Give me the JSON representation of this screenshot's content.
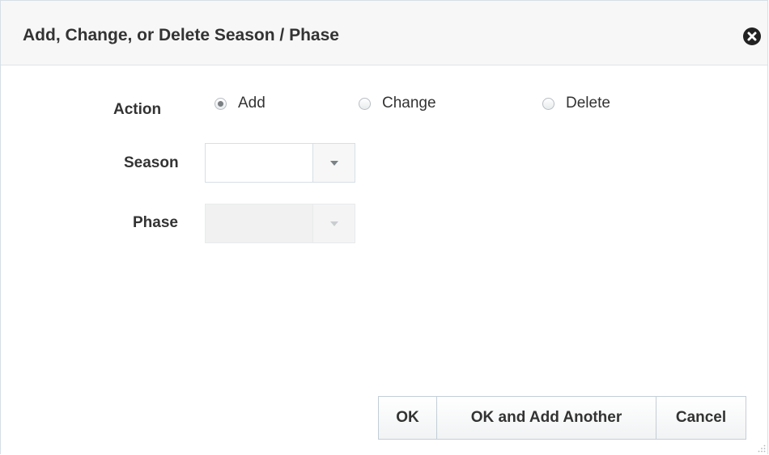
{
  "dialog": {
    "title": "Add, Change, or Delete Season / Phase"
  },
  "form": {
    "action_label": "Action",
    "action_options": [
      "Add",
      "Change",
      "Delete"
    ],
    "action_selected": "Add",
    "season_label": "Season",
    "season_value": "",
    "phase_label": "Phase",
    "phase_value": ""
  },
  "buttons": {
    "ok": "OK",
    "ok_add_another": "OK and Add Another",
    "cancel": "Cancel"
  },
  "colors": {
    "titlebar_bg": "#f7f7f7",
    "border": "#d6dfe6",
    "text": "#333333"
  }
}
